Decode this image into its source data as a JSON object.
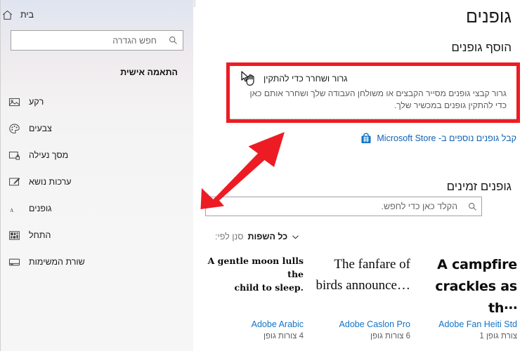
{
  "window": {
    "page_title": "גופנים"
  },
  "main": {
    "add_fonts_heading": "הוסף גופנים",
    "dropzone": {
      "title": "גרור ושחרר כדי להתקין",
      "description": "גרור קבצי גופנים מסייר הקבצים או משולחן העבודה שלך ושחרר אותם כאן כדי להתקין גופנים במכשיר שלך.",
      "cursor_icon": "drag-cursor-icon"
    },
    "store_link": {
      "text": "קבל גופנים נוספים ב- Microsoft Store",
      "icon": "microsoft-store-bag-icon",
      "color": "#0f62b4"
    },
    "available_fonts_heading": "גופנים זמינים",
    "font_search": {
      "placeholder": "הקלד כאן כדי לחפש.",
      "value": "",
      "icon": "search-icon"
    },
    "filter": {
      "label": "סנן לפי:",
      "value": "כל השפות",
      "icon": "chevron-down-icon"
    },
    "font_cards": [
      {
        "preview_lines": [
          "A campfire",
          "crackles as th⋯"
        ],
        "name": "Adobe Fan Heiti Std",
        "faces": "צורת גופן 1"
      },
      {
        "preview_lines": [
          "The fanfare of",
          "birds announce…"
        ],
        "name": "Adobe Caslon Pro",
        "faces": "6 צורות גופן"
      },
      {
        "preview_lines": [
          "A gentle moon lulls the",
          "child to sleep."
        ],
        "name": "Adobe Arabic",
        "faces": "4 צורות גופן"
      }
    ]
  },
  "sidebar": {
    "home": {
      "label": "בית",
      "icon": "home-icon"
    },
    "search": {
      "placeholder": "חפש הגדרה",
      "value": "",
      "icon": "search-icon"
    },
    "group_title": "התאמה אישית",
    "items": [
      {
        "label": "רקע",
        "icon": "picture-icon"
      },
      {
        "label": "צבעים",
        "icon": "palette-icon"
      },
      {
        "label": "מסך נעילה",
        "icon": "lock-screen-icon"
      },
      {
        "label": "ערכות נושא",
        "icon": "theme-brush-icon"
      },
      {
        "label": "גופנים",
        "icon": "fonts-aa-icon"
      },
      {
        "label": "התחל",
        "icon": "start-grid-icon"
      },
      {
        "label": "שורת המשימות",
        "icon": "taskbar-icon"
      }
    ]
  },
  "annotations": {
    "highlight_box_color": "#ed1c24",
    "arrow_color": "#ed1c24",
    "arrow_icon": "red-arrow-up-right-icon"
  }
}
